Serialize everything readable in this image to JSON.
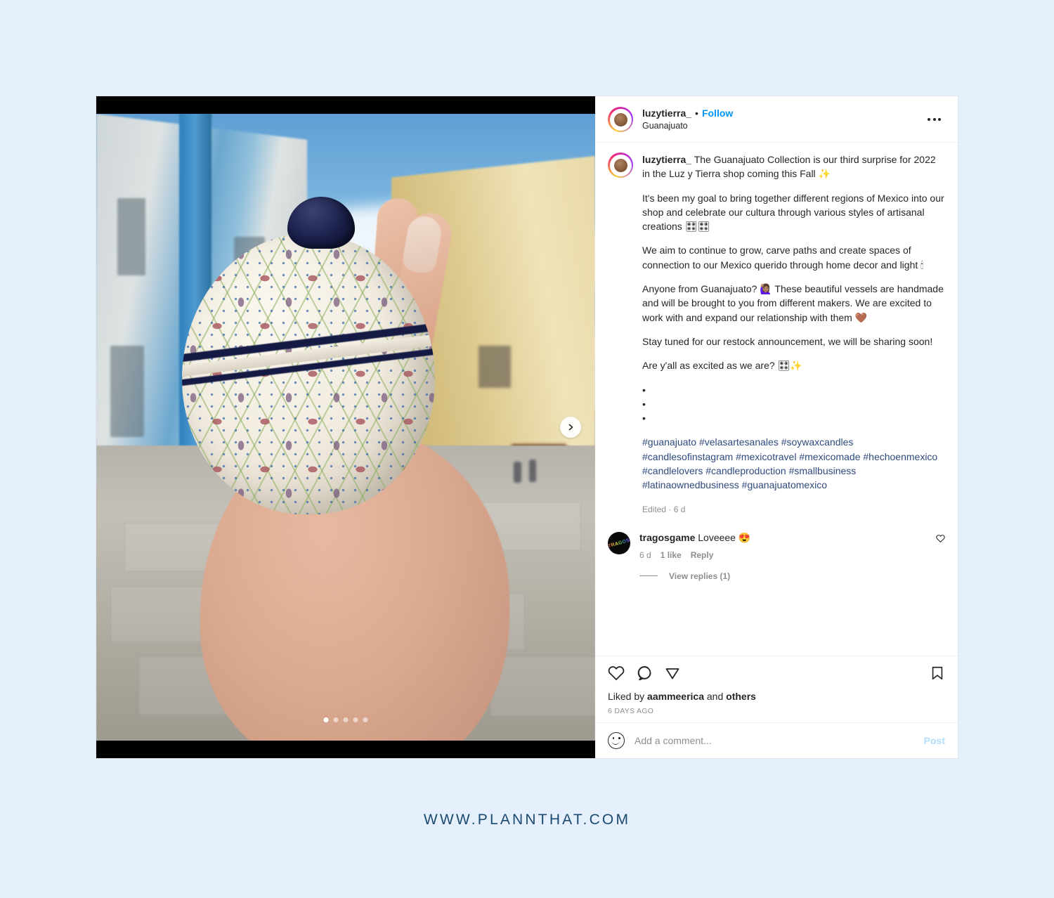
{
  "theme": {
    "page_background": "#e6f0fd",
    "accent_blue": "#0095f6",
    "hashtag_blue": "#2e4a7d",
    "text_primary": "#262626",
    "text_muted": "#8e8e8e",
    "footer_color": "#1b4a70"
  },
  "header": {
    "username": "luzytierra_",
    "separator": "•",
    "follow_label": "Follow",
    "location": "Guanajuato",
    "more_icon": "more-options-icon"
  },
  "caption": {
    "username": "luzytierra_",
    "paragraphs": [
      "The Guanajuato Collection is our third surprise for 2022 in the Luz y Tierra shop coming this Fall ✨",
      "It's been my goal to bring together different regions of Mexico into our shop and celebrate our cultura through various styles of artisanal creations 🎛🎛",
      "We aim to continue to grow, carve paths and create spaces of connection to our Mexico querido through home decor and light 🕯",
      "Anyone from Guanajuato? 🙋🏽‍♀️ These beautiful vessels are handmade and will be brought to you from different makers. We are excited to work with and expand our relationship with them 🤎",
      "Stay tuned for our restock announcement, we will be sharing soon!",
      "Are y'all as excited as we are? 🎛✨"
    ],
    "bullets": [
      "•",
      "•",
      "•"
    ],
    "hashtags": "#guanajuato #velasartesanales #soywaxcandles #candlesofinstagram #mexicotravel #mexicomade #hechoenmexico #candlelovers #candleproduction #smallbusiness #latinaownedbusiness #guanajuatomexico",
    "edited_meta": "Edited · 6 d"
  },
  "comments": [
    {
      "username": "tragosgame",
      "text": "Loveeee 😍",
      "avatar_text": "TRAGOS",
      "time": "6 d",
      "likes": "1 like",
      "reply_label": "Reply",
      "like_icon": "heart-icon"
    }
  ],
  "view_replies_label": "View replies (1)",
  "actions": {
    "like_icon": "heart-icon",
    "comment_icon": "comment-bubble-icon",
    "share_icon": "share-paperplane-icon",
    "save_icon": "bookmark-icon"
  },
  "likes_line": {
    "prefix": "Liked by ",
    "user": "aammeerica",
    "middle": " and ",
    "suffix": "others"
  },
  "timestamp": "6 DAYS AGO",
  "add_comment": {
    "emoji_icon": "emoji-smiley-icon",
    "placeholder": "Add a comment...",
    "value": "",
    "post_label": "Post"
  },
  "media": {
    "next_icon": "chevron-right-icon",
    "dots_total": 5,
    "dots_active_index": 0,
    "alt": "Hand holding a painted ceramic talavera vessel on a Mexican street"
  },
  "footer": {
    "watermark": "WWW.PLANNTHAT.COM"
  }
}
